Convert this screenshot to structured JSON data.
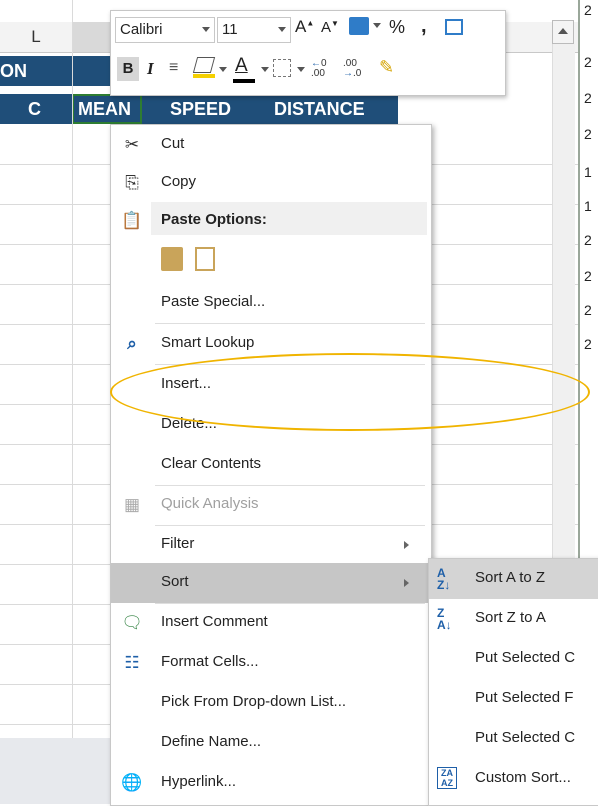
{
  "sheet": {
    "col_header_L": "L",
    "banner_text": "ON",
    "headers": {
      "c": "C",
      "mean": "MEAN",
      "speed": "SPEED",
      "distance": "DISTANCE"
    },
    "right_numbers": [
      "2",
      "2",
      "2",
      "2",
      "1",
      "1",
      "2",
      "2",
      "2",
      "2"
    ],
    "header_color": "#1f4e79"
  },
  "mini_toolbar": {
    "font_name": "Calibri",
    "font_size": "11",
    "percent": "%",
    "comma": ",",
    "bold": "B",
    "italic": "I",
    "font_color_letter": "A",
    "increase_decimal": ".00",
    "decrease_decimal": ".0"
  },
  "context_menu": {
    "cut": "Cut",
    "copy": "Copy",
    "paste_options": "Paste Options:",
    "paste_special": "Paste Special...",
    "smart_lookup": "Smart Lookup",
    "insert": "Insert...",
    "delete": "Delete...",
    "clear_contents": "Clear Contents",
    "quick_analysis": "Quick Analysis",
    "filter": "Filter",
    "sort": "Sort",
    "insert_comment": "Insert Comment",
    "format_cells": "Format Cells...",
    "pick_from_list": "Pick From Drop-down List...",
    "define_name": "Define Name...",
    "hyperlink": "Hyperlink..."
  },
  "sort_submenu": {
    "sort_a_to_z": "Sort A to Z",
    "sort_z_to_a": "Sort Z to A",
    "put_selected_1": "Put Selected C",
    "put_selected_2": "Put Selected F",
    "put_selected_3": "Put Selected C",
    "custom_sort": "Custom Sort..."
  },
  "annotation_color": "#f0b400"
}
